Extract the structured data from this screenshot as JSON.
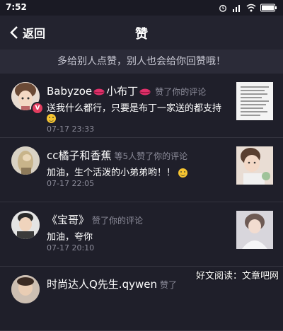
{
  "status_bar": {
    "time": "7:52"
  },
  "header": {
    "back_label": "返回",
    "title": "赞"
  },
  "hint": "多给别人点赞，别人也会给你回赞哦！",
  "items": [
    {
      "username_a": "Babyzoe",
      "username_b": "小布丁",
      "action": "赞了你的评论",
      "comment": "送我什么都行，只要是布丁一家送的都支持",
      "time": "07-17 23:33",
      "badge": "V"
    },
    {
      "username": "cc橘子和香蕉",
      "action": "等5人赞了你的评论",
      "comment": "加油，生个活泼的小弟弟哟！！",
      "time": "07-17 22:05"
    },
    {
      "username": "《宝哥》",
      "action": "赞了你的评论",
      "comment": "加油，夸你",
      "time": "07-17 20:10"
    },
    {
      "username": "时尚达人Q先生.qywen",
      "action": "赞了"
    }
  ],
  "watermark": "好文阅读：文章吧网",
  "colors": {
    "background": "#1f1f2a",
    "muted": "#8c8c9a",
    "badge": "#e23d5f"
  }
}
